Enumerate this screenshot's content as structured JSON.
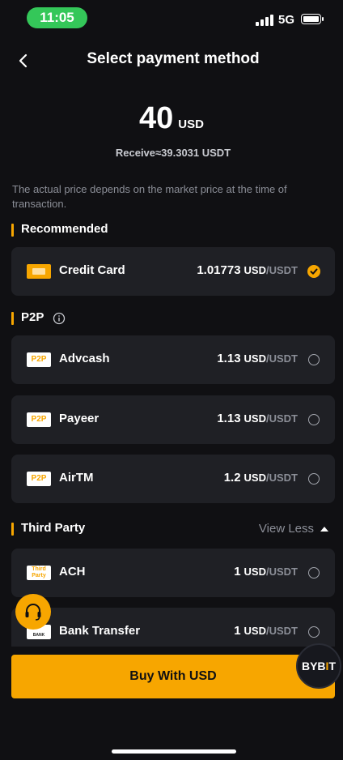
{
  "status": {
    "time": "11:05",
    "network": "5G"
  },
  "header": {
    "title": "Select payment method"
  },
  "amount": {
    "value": "40",
    "currency": "USD",
    "receive": "Receive≈39.3031 USDT"
  },
  "notice": "The actual price depends on the market price at the time of transaction.",
  "sections": {
    "recommended": "Recommended",
    "p2p": "P2P",
    "third_party": "Third Party",
    "view_less": "View Less"
  },
  "methods": {
    "credit_card": {
      "logo": "",
      "name": "Credit Card",
      "price": "1.01773",
      "unit1": "USD",
      "unit2": "/USDT",
      "selected": true
    },
    "advcash": {
      "logo": "P2P",
      "name": "Advcash",
      "price": "1.13",
      "unit1": "USD",
      "unit2": "/USDT",
      "selected": false
    },
    "payeer": {
      "logo": "P2P",
      "name": "Payeer",
      "price": "1.13",
      "unit1": "USD",
      "unit2": "/USDT",
      "selected": false
    },
    "airtm": {
      "logo": "P2P",
      "name": "AirTM",
      "price": "1.2",
      "unit1": "USD",
      "unit2": "/USDT",
      "selected": false
    },
    "ach": {
      "logo_line1": "Third",
      "logo_line2": "Party",
      "name": "ACH",
      "price": "1",
      "unit1": "USD",
      "unit2": "/USDT",
      "selected": false
    },
    "bank_transfer": {
      "logo": "BANK",
      "name": "Bank Transfer",
      "price": "1",
      "unit1": "USD",
      "unit2": "/USDT",
      "selected": false
    }
  },
  "buy_button": "Buy With USD",
  "brand": {
    "text_pre": "BYB",
    "text_i": "I",
    "text_post": "T"
  },
  "colors": {
    "accent": "#f7a600",
    "background": "#101013",
    "card": "#1f2025",
    "muted": "#8b8e97",
    "status_green": "#34c759"
  },
  "icons": [
    "back-chevron-icon",
    "info-icon",
    "checkmark-icon",
    "radio-icon",
    "headset-icon",
    "credit-card-icon",
    "triangle-up-icon"
  ]
}
